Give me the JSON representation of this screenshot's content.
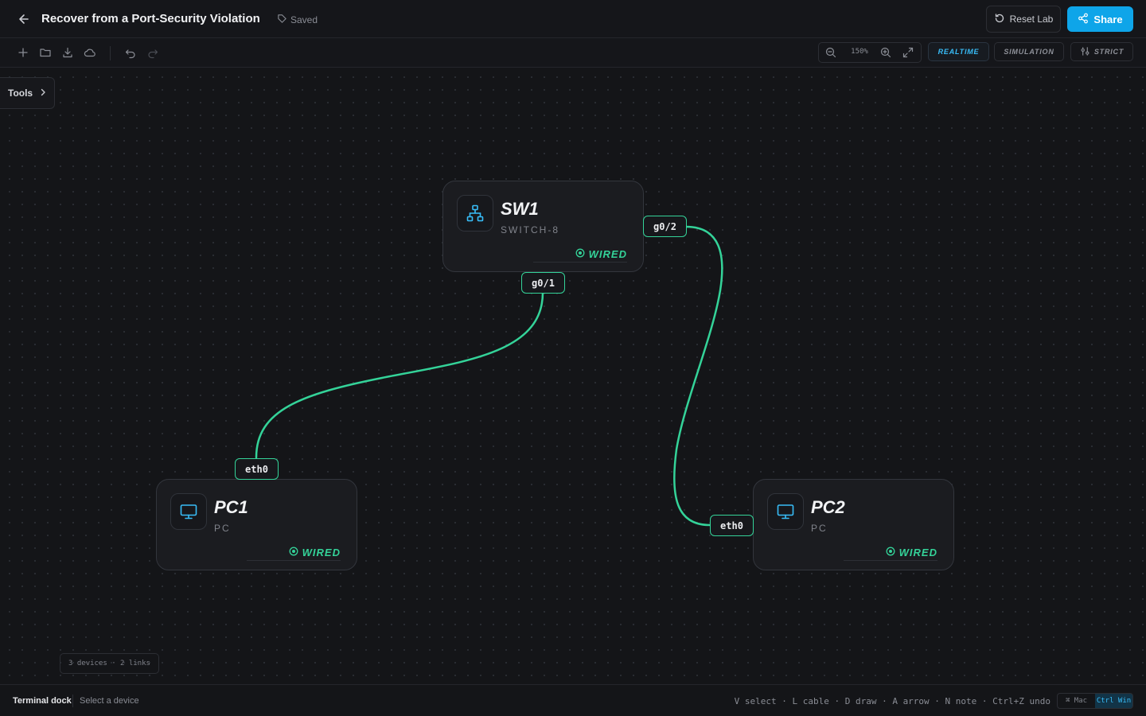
{
  "header": {
    "title": "Recover from a Port-Security Violation",
    "saved_label": "Saved",
    "reset_label": "Reset Lab",
    "share_label": "Share"
  },
  "toolbar": {
    "zoom_level": "150%",
    "modes": [
      "REALTIME",
      "SIMULATION",
      "STRICT"
    ],
    "active_mode": "REALTIME"
  },
  "canvas": {
    "tools_label": "Tools",
    "devices": [
      {
        "id": "SW1",
        "name": "SW1",
        "type": "SWITCH-8",
        "status": "WIRED",
        "icon": "network-switch-icon"
      },
      {
        "id": "PC1",
        "name": "PC1",
        "type": "PC",
        "status": "WIRED",
        "icon": "monitor-icon"
      },
      {
        "id": "PC2",
        "name": "PC2",
        "type": "PC",
        "status": "WIRED",
        "icon": "monitor-icon"
      }
    ],
    "links": [
      {
        "from": "SW1",
        "from_port": "g0/1",
        "to": "PC1",
        "to_port": "eth0"
      },
      {
        "from": "SW1",
        "from_port": "g0/2",
        "to": "PC2",
        "to_port": "eth0"
      }
    ],
    "summary": "3 devices · 2 links"
  },
  "footer": {
    "dock_label": "Terminal dock",
    "dock_hint": "Select a device",
    "shortcuts": "V select · L cable · D draw · A arrow · N note · Ctrl+Z undo",
    "os_options": [
      "⌘ Mac",
      "Ctrl Win"
    ],
    "active_os": "Ctrl Win"
  },
  "colors": {
    "accent": "#0ea5e9",
    "link": "#34d399",
    "background": "#141518"
  }
}
